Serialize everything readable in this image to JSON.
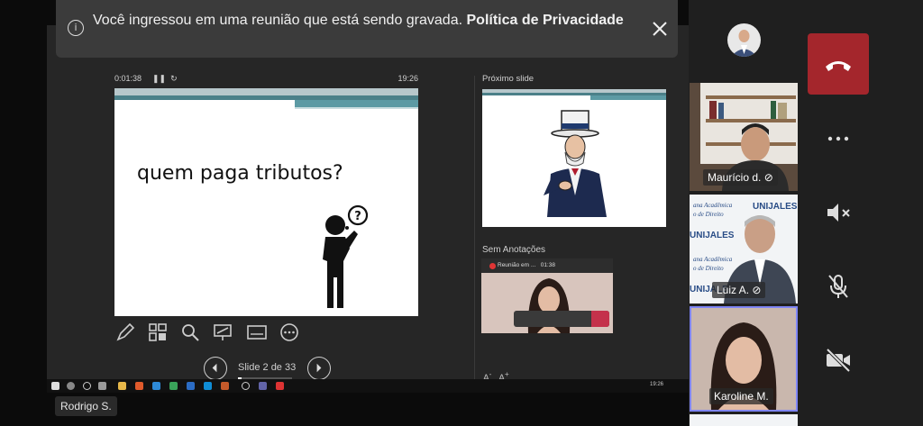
{
  "presenter": {
    "elapsed": "0:01:38",
    "clock": "19:26",
    "slide_text": "quem paga tributos?",
    "slide_counter": "Slide 2 de 33",
    "progress": 0.06
  },
  "next_slide": {
    "label": "Próximo slide"
  },
  "notes": {
    "label": "Sem Anotações"
  },
  "self_view": {
    "recording_label": "Reunião em ...",
    "time": "01:38"
  },
  "taskbar": {
    "clock": "19:26"
  },
  "presenter_name": "Rodrigo S.",
  "toast": {
    "message": "Você ingressou em uma reunião que está sendo gravada.",
    "link": "Política de Privacidade"
  },
  "participants": [
    {
      "name": "Maurício d."
    },
    {
      "name": "Luiz A."
    },
    {
      "name": "Karoline M."
    }
  ],
  "tile_banner_text": {
    "line1": "ana Acadêmica",
    "line2": "o de Direito",
    "brand": "UNIJALES"
  },
  "colors": {
    "hangup": "#a4262c",
    "active_speaker": "#7f85f5",
    "slide_accent": "#4b8089"
  }
}
